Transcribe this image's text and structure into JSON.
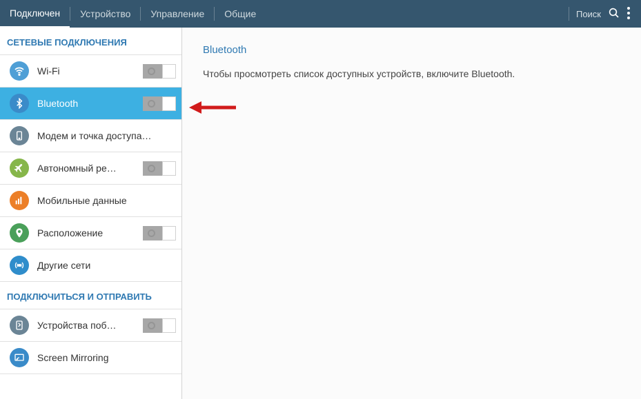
{
  "header": {
    "tabs": [
      "Подключен",
      "Устройство",
      "Управление",
      "Общие"
    ],
    "active_tab": 0,
    "search_label": "Поиск"
  },
  "sidebar": {
    "section1": {
      "title": "СЕТЕВЫЕ ПОДКЛЮЧЕНИЯ",
      "items": [
        {
          "label": "Wi-Fi",
          "icon": "wifi",
          "color": "c-wifi",
          "toggle": true,
          "on": false
        },
        {
          "label": "Bluetooth",
          "icon": "bluetooth",
          "color": "c-bt",
          "toggle": true,
          "on": false,
          "selected": true
        },
        {
          "label": "Модем и точка доступа…",
          "icon": "tethering",
          "color": "c-teth",
          "toggle": false
        },
        {
          "label": "Автономный ре…",
          "icon": "airplane",
          "color": "c-air",
          "toggle": true,
          "on": false
        },
        {
          "label": "Мобильные данные",
          "icon": "mobile-data",
          "color": "c-mobile",
          "toggle": false
        },
        {
          "label": "Расположение",
          "icon": "location",
          "color": "c-loc",
          "toggle": true,
          "on": false
        },
        {
          "label": "Другие сети",
          "icon": "more-networks",
          "color": "c-net",
          "toggle": false
        }
      ]
    },
    "section2": {
      "title": "ПОДКЛЮЧИТЬСЯ И ОТПРАВИТЬ",
      "items": [
        {
          "label": "Устройства поб…",
          "icon": "nearby-devices",
          "color": "c-dev",
          "toggle": true,
          "on": false
        },
        {
          "label": "Screen Mirroring",
          "icon": "screen-mirroring",
          "color": "c-mirror",
          "toggle": false
        }
      ]
    }
  },
  "content": {
    "title": "Bluetooth",
    "text": "Чтобы просмотреть список доступных устройств, включите Bluetooth."
  },
  "colors": {
    "header_bg": "#35566e",
    "accent": "#2f79b2",
    "selected_bg": "#3db0e2",
    "arrow": "#d11b1b"
  }
}
